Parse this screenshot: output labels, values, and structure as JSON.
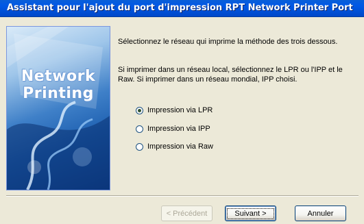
{
  "window": {
    "title": "Assistant pour l'ajout du port d'impression RPT Network Printer Port"
  },
  "graphic": {
    "logo_line1": "Network",
    "logo_line2": "Printing"
  },
  "instructions": {
    "paragraph1": "Sélectionnez le réseau qui imprime la méthode des trois dessous.",
    "paragraph2": "Si imprimer dans un réseau local, sélectionnez le LPR ou l'IPP et le Raw.  Si imprimer dans un réseau mondial, IPP choisi."
  },
  "options": [
    {
      "label": "Impression via LPR",
      "selected": true
    },
    {
      "label": "Impression via IPP",
      "selected": false
    },
    {
      "label": "Impression via Raw",
      "selected": false
    }
  ],
  "buttons": {
    "previous": "< Précédent",
    "next": "Suivant >",
    "cancel": "Annuler"
  },
  "colors": {
    "titlebar": "#0054e3",
    "dialog_bg": "#ece9d8"
  }
}
